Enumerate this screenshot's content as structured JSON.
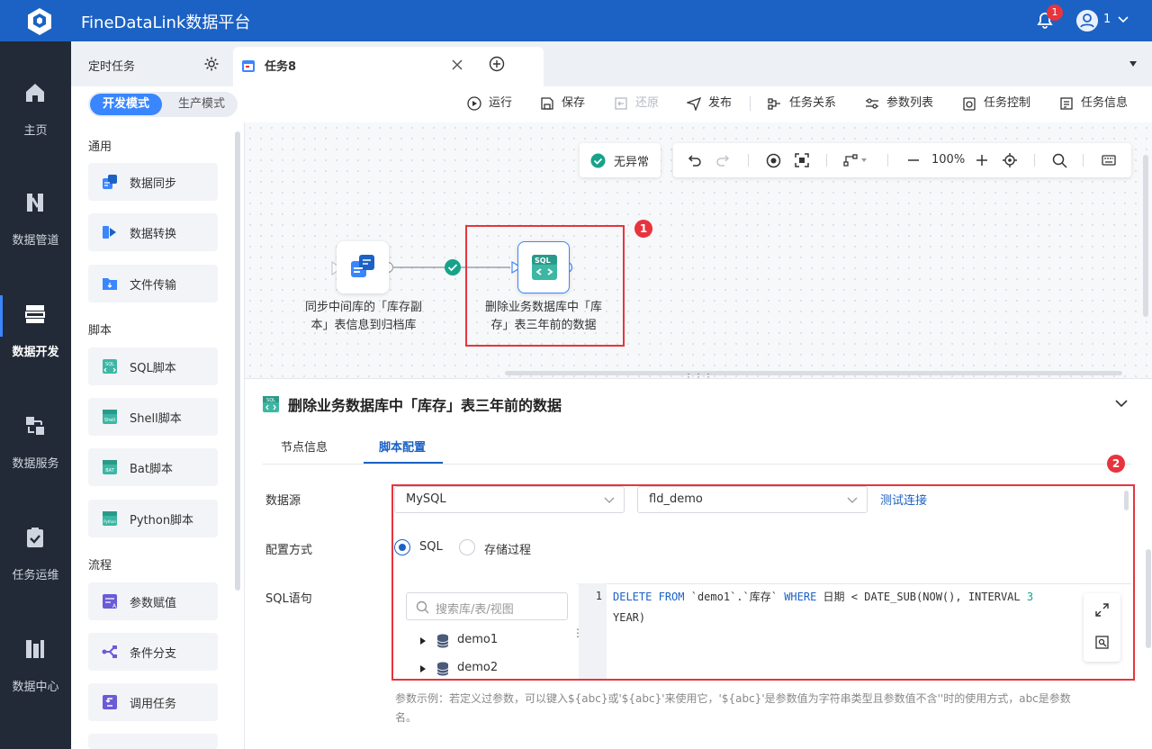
{
  "app": {
    "title": "FineDataLink数据平台",
    "notification_count": "1",
    "user_num": "1"
  },
  "nav": {
    "home": "主页",
    "pipeline": "数据管道",
    "dev": "数据开发",
    "service": "数据服务",
    "ops": "任务运维",
    "center": "数据中心"
  },
  "tabs": {
    "scheduled": "定时任务",
    "task": "任务8"
  },
  "mode": {
    "dev": "开发模式",
    "prod": "生产模式"
  },
  "toolbar": {
    "run": "运行",
    "save": "保存",
    "restore": "还原",
    "publish": "发布",
    "relation": "任务关系",
    "params": "参数列表",
    "control": "任务控制",
    "info": "任务信息"
  },
  "sidebar": {
    "general": "通用",
    "general_items": [
      "数据同步",
      "数据转换",
      "文件传输"
    ],
    "script": "脚本",
    "script_items": [
      "SQL脚本",
      "Shell脚本",
      "Bat脚本",
      "Python脚本"
    ],
    "flow": "流程",
    "flow_items": [
      "参数赋值",
      "条件分支",
      "调用任务"
    ]
  },
  "canvas": {
    "status": "无异常",
    "zoom": "100%",
    "node1_label_l1": "同步中间库的「库存副",
    "node1_label_l2": "本」表信息到归档库",
    "node2_label_l1": "删除业务数据库中「库",
    "node2_label_l2": "存」表三年前的数据",
    "node2_icon_text": "SQL",
    "marker1": "1",
    "marker2": "2"
  },
  "panel": {
    "title": "删除业务数据库中「库存」表三年前的数据",
    "tab_node": "节点信息",
    "tab_script": "脚本配置",
    "label_datasource": "数据源",
    "datasource_type": "MySQL",
    "datasource_db": "fld_demo",
    "test_connection": "测试连接",
    "label_config": "配置方式",
    "radio_sql": "SQL",
    "radio_proc": "存储过程",
    "label_sql": "SQL语句",
    "search_placeholder": "搜索库/表/视图",
    "tree": [
      "demo1",
      "demo2"
    ],
    "line_no": "1",
    "code": {
      "kw1": "DELETE",
      "kw2": "FROM",
      "tbl": " `demo1`.`库存` ",
      "kw3": "WHERE",
      "rest": " 日期 < DATE_SUB(NOW(), INTERVAL ",
      "num": "3",
      "line2": "YEAR)"
    },
    "hint_l1": "参数示例：若定义过参数，可以键入${abc}或'${abc}'来使用它，'${abc}'是参数值为字符串类型且参数值不含''时的使用方式，abc是参数",
    "hint_l2": "名。"
  },
  "colors": {
    "brand": "#1c62c4",
    "nav_bg": "#222a37",
    "accent": "#3a86ff",
    "alert": "#e7343d",
    "success": "#17a38a"
  }
}
